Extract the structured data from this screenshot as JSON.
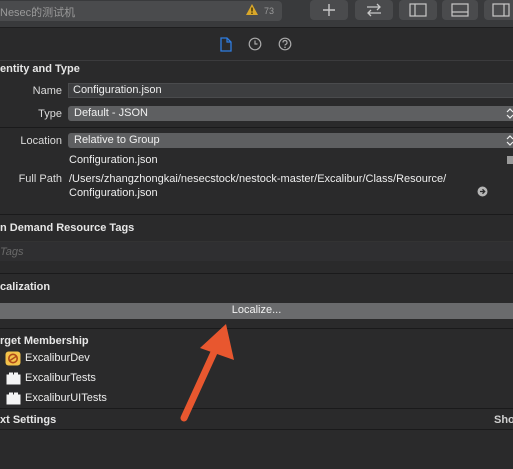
{
  "toolbar": {
    "scheme_label": "Nesec的测试机",
    "warning_count": "73"
  },
  "identity": {
    "section_title": "entity and Type",
    "name_label": "Name",
    "name_value": "Configuration.json",
    "type_label": "Type",
    "type_value": "Default - JSON",
    "location_label": "Location",
    "location_value": "Relative to Group",
    "location_file": "Configuration.json",
    "fullpath_label": "Full Path",
    "fullpath_line1": "/Users/zhangzhongkai/nesecstock/nestock-master/Excalibur/Class/Resource/",
    "fullpath_line2": "Configuration.json"
  },
  "odr": {
    "section_title": "n Demand Resource Tags",
    "tags_placeholder": "Tags"
  },
  "localization": {
    "section_title": "calization",
    "localize_button": "Localize..."
  },
  "membership": {
    "section_title": "rget Membership",
    "targets": [
      {
        "name": "ExcaliburDev",
        "icon": "app-target-icon"
      },
      {
        "name": "ExcaliburTests",
        "icon": "bundle-target-icon"
      },
      {
        "name": "ExcaliburUITests",
        "icon": "bundle-target-icon"
      }
    ]
  },
  "text_settings": {
    "section_title": "xt Settings",
    "show_label": "Sho"
  },
  "colors": {
    "accent_blue": "#2f7de1",
    "arrow_orange": "#e8572f",
    "background": "#2a2a2b"
  }
}
